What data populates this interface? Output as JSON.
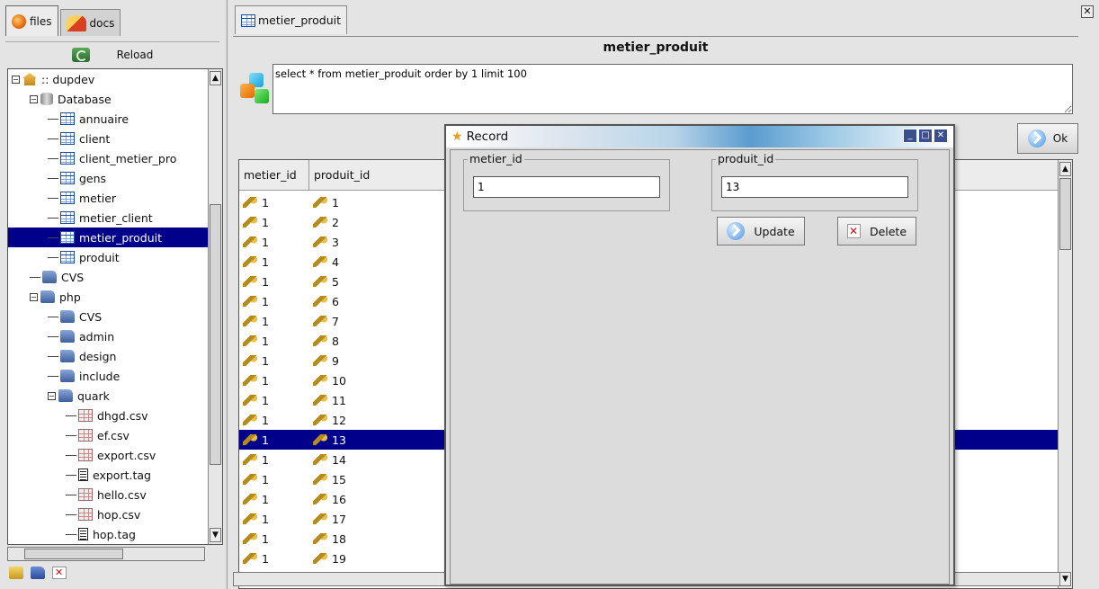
{
  "left_panel": {
    "tabs": [
      {
        "label": "files"
      },
      {
        "label": "docs"
      }
    ],
    "reload_label": "Reload",
    "tree": [
      {
        "label": ":: dupdev",
        "icon": "home-icon",
        "depth": 0,
        "toggle": "−"
      },
      {
        "label": "Database",
        "icon": "database-icon",
        "depth": 1,
        "toggle": "−"
      },
      {
        "label": "annuaire",
        "icon": "table-icon",
        "depth": 2
      },
      {
        "label": "client",
        "icon": "table-icon",
        "depth": 2
      },
      {
        "label": "client_metier_pro",
        "icon": "table-icon",
        "depth": 2
      },
      {
        "label": "gens",
        "icon": "table-icon",
        "depth": 2
      },
      {
        "label": "metier",
        "icon": "table-icon",
        "depth": 2
      },
      {
        "label": "metier_client",
        "icon": "table-icon",
        "depth": 2
      },
      {
        "label": "metier_produit",
        "icon": "table-icon",
        "depth": 2,
        "selected": true
      },
      {
        "label": "produit",
        "icon": "table-icon",
        "depth": 2
      },
      {
        "label": "CVS",
        "icon": "folder-icon",
        "depth": 1
      },
      {
        "label": "php",
        "icon": "folder-icon",
        "depth": 1,
        "toggle": "−"
      },
      {
        "label": "CVS",
        "icon": "folder-icon",
        "depth": 2
      },
      {
        "label": "admin",
        "icon": "folder-icon",
        "depth": 2
      },
      {
        "label": "design",
        "icon": "folder-icon",
        "depth": 2
      },
      {
        "label": "include",
        "icon": "folder-icon",
        "depth": 2
      },
      {
        "label": "quark",
        "icon": "folder-icon",
        "depth": 2,
        "toggle": "−"
      },
      {
        "label": "dhgd.csv",
        "icon": "csv-icon",
        "depth": 3
      },
      {
        "label": "ef.csv",
        "icon": "csv-icon",
        "depth": 3
      },
      {
        "label": "export.csv",
        "icon": "csv-icon",
        "depth": 3
      },
      {
        "label": "export.tag",
        "icon": "tag-file-icon",
        "depth": 3
      },
      {
        "label": "hello.csv",
        "icon": "csv-icon",
        "depth": 3
      },
      {
        "label": "hop.csv",
        "icon": "csv-icon",
        "depth": 3
      },
      {
        "label": "hop.tag",
        "icon": "tag-file-icon",
        "depth": 3
      }
    ]
  },
  "main": {
    "tab_label": "metier_produit",
    "query_title": "metier_produit",
    "query_text": "select * from metier_produit order by 1 limit 100",
    "ok_label": "Ok",
    "columns": [
      "metier_id",
      "produit_id"
    ],
    "rows": [
      [
        "1",
        "1"
      ],
      [
        "1",
        "2"
      ],
      [
        "1",
        "3"
      ],
      [
        "1",
        "4"
      ],
      [
        "1",
        "5"
      ],
      [
        "1",
        "6"
      ],
      [
        "1",
        "7"
      ],
      [
        "1",
        "8"
      ],
      [
        "1",
        "9"
      ],
      [
        "1",
        "10"
      ],
      [
        "1",
        "11"
      ],
      [
        "1",
        "12"
      ],
      [
        "1",
        "13"
      ],
      [
        "1",
        "14"
      ],
      [
        "1",
        "15"
      ],
      [
        "1",
        "16"
      ],
      [
        "1",
        "17"
      ],
      [
        "1",
        "18"
      ],
      [
        "1",
        "19"
      ]
    ],
    "selected_row_index": 12
  },
  "dialog": {
    "title": "Record",
    "fields": [
      {
        "legend": "metier_id",
        "value": "1"
      },
      {
        "legend": "produit_id",
        "value": "13"
      }
    ],
    "update_label": "Update",
    "delete_label": "Delete"
  }
}
